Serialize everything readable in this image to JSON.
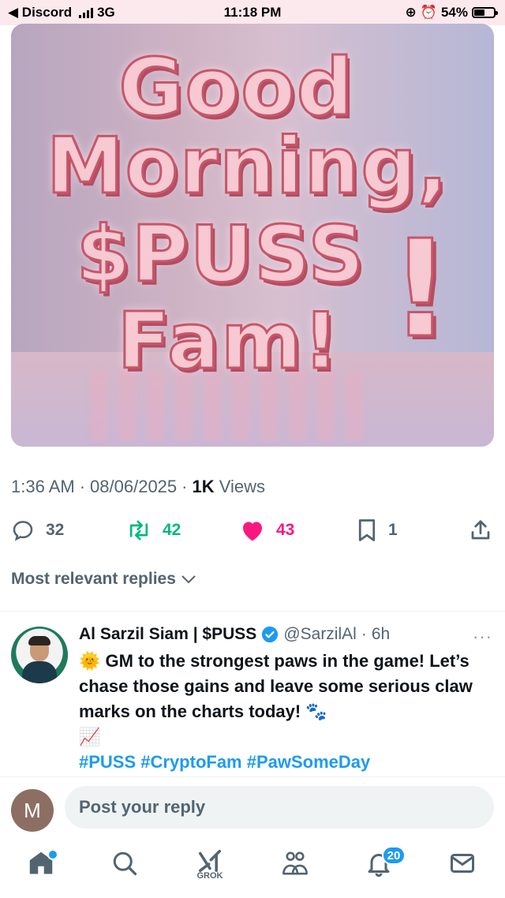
{
  "status_bar": {
    "back_app": "◀ Discord",
    "network": "3G",
    "time": "11:18 PM",
    "battery_percent": "54%",
    "battery_level": 0.54
  },
  "image": {
    "lines": [
      "Good",
      "Morning,",
      "$PUSS",
      "Fam!"
    ],
    "exclaim": "!"
  },
  "meta": {
    "time": "1:36 AM",
    "date": "08/06/2025",
    "views_count": "1K",
    "views_label": "Views"
  },
  "actions": {
    "replies": "32",
    "reposts": "42",
    "likes": "43",
    "bookmarks": "1"
  },
  "sort": {
    "label": "Most relevant replies"
  },
  "reply": {
    "name": "Al Sarzil Siam | $PUSS",
    "handle": "@SarzilAl",
    "age": "6h",
    "emoji_sun": "🌞",
    "text": "GM to the strongest paws in the game! Let’s chase those gains and leave some serious claw marks on the charts today!",
    "emoji_paws": "🐾",
    "emoji_chart": "📈",
    "hashtags": "#PUSS #CryptoFam #PawSomeDay"
  },
  "compose": {
    "avatar_letter": "M",
    "placeholder": "Post your reply"
  },
  "nav": {
    "grok_label": "GROK",
    "notifications_count": "20"
  },
  "colors": {
    "like": "#f91880",
    "repost": "#00ba7c",
    "link": "#1d9bf0",
    "muted": "#536471"
  }
}
